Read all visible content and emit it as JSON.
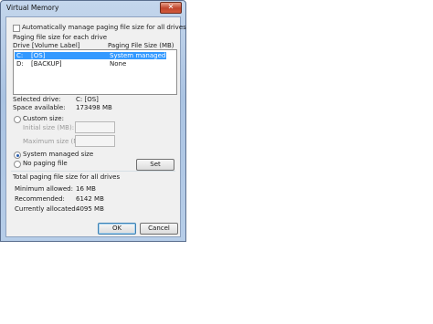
{
  "window": {
    "title": "Virtual Memory",
    "close_glyph": "✕"
  },
  "auto_manage": {
    "label": "Automatically manage paging file size for all drives",
    "checked": false
  },
  "drives_group": {
    "title": "Paging file size for each drive",
    "col_drive": "Drive  [Volume Label]",
    "col_size": "Paging File Size (MB)",
    "rows": [
      {
        "drive": "C:",
        "label": "[OS]",
        "size": "System managed",
        "selected": true
      },
      {
        "drive": "D:",
        "label": "[BACKUP]",
        "size": "None",
        "selected": false
      }
    ],
    "selected_drive_label": "Selected drive:",
    "selected_drive_value": "C:  [OS]",
    "space_label": "Space available:",
    "space_value": "173498 MB",
    "custom_size_label": "Custom size:",
    "initial_size_label": "Initial size (MB):",
    "maximum_size_label": "Maximum size (MB):",
    "system_managed_label": "System managed size",
    "no_paging_label": "No paging file",
    "selected_option": "system_managed",
    "set_button": "Set"
  },
  "total_group": {
    "title": "Total paging file size for all drives",
    "min_label": "Minimum allowed:",
    "min_value": "16 MB",
    "rec_label": "Recommended:",
    "rec_value": "6142 MB",
    "cur_label": "Currently allocated:",
    "cur_value": "4095 MB"
  },
  "buttons": {
    "ok": "OK",
    "cancel": "Cancel"
  },
  "colors": {
    "selection": "#3399ff",
    "frame": "#aac3e2"
  }
}
